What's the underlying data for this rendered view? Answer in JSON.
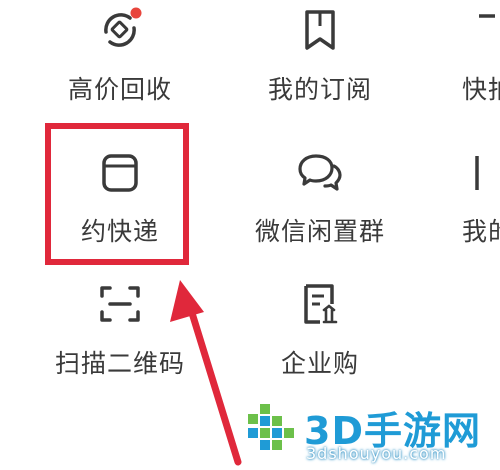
{
  "grid": {
    "row1": [
      {
        "label": "高价回收",
        "icon": "recycle-icon",
        "has_badge": true
      },
      {
        "label": "我的订阅",
        "icon": "bookmark-icon"
      },
      {
        "label": "快拍",
        "icon": "camera-icon",
        "partial": true
      }
    ],
    "row2": [
      {
        "label": "约快递",
        "icon": "package-icon",
        "highlighted": true
      },
      {
        "label": "微信闲置群",
        "icon": "chat-bubbles-icon"
      },
      {
        "label": "我的",
        "icon": "document-icon",
        "partial": true
      }
    ],
    "row3": [
      {
        "label": "扫描二维码",
        "icon": "scan-icon"
      },
      {
        "label": "企业购",
        "icon": "enterprise-icon"
      }
    ]
  },
  "annotation": {
    "highlight_color": "#e0283b",
    "arrow_color": "#e0283b"
  },
  "watermark": {
    "brand": "3D手游网",
    "url": "3dshouyou.com",
    "color": "#1f9bd6"
  },
  "colors": {
    "icon_stroke": "#3a3a3a",
    "label_text": "#3a3a3a",
    "badge": "#e8453c",
    "background": "#ffffff"
  }
}
